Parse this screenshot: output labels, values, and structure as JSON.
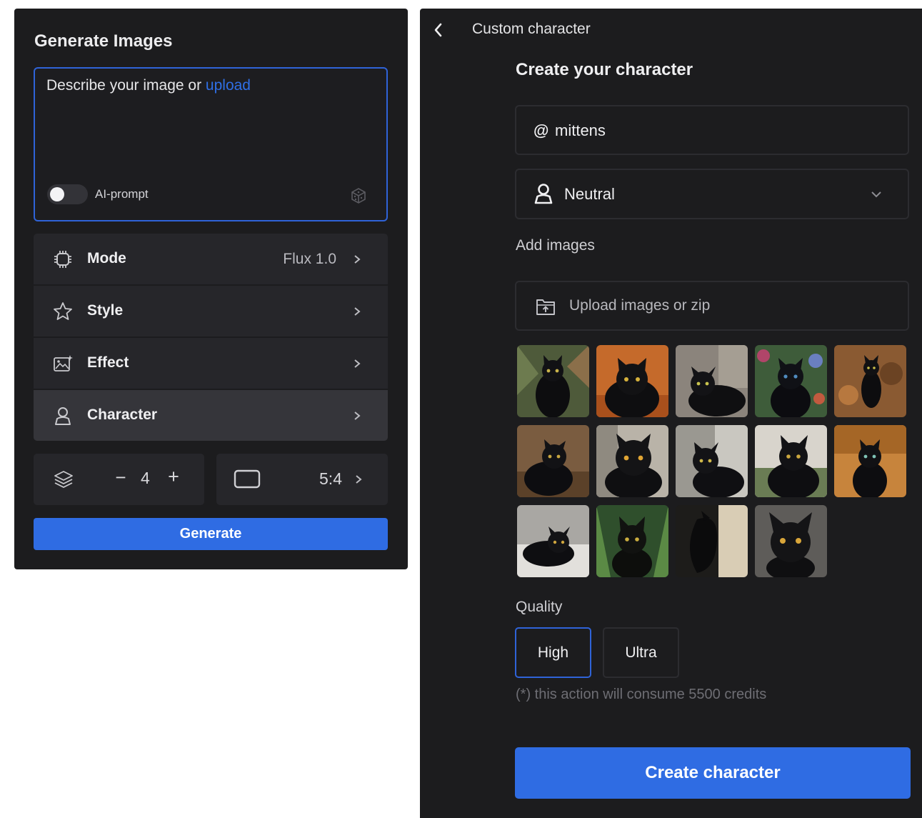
{
  "generate_panel": {
    "title": "Generate Images",
    "prompt": {
      "text": "Describe your image or ",
      "upload_link": "upload",
      "ai_prompt_label": "AI-prompt",
      "ai_prompt_enabled": false,
      "dice_icon": "dice-icon"
    },
    "menu": [
      {
        "icon": "chip-icon",
        "label": "Mode",
        "value": "Flux 1.0"
      },
      {
        "icon": "star-icon",
        "label": "Style",
        "value": ""
      },
      {
        "icon": "image-sparkle-icon",
        "label": "Effect",
        "value": ""
      },
      {
        "icon": "person-icon",
        "label": "Character",
        "value": "",
        "active": true
      }
    ],
    "count": {
      "icon": "layers-icon",
      "minus": "−",
      "value": "4",
      "plus": "+"
    },
    "ratio": {
      "icon": "aspect-ratio-icon",
      "value": "5:4"
    },
    "generate_label": "Generate",
    "accent": "#2f6ce3"
  },
  "character_panel": {
    "header": "Custom character",
    "title": "Create your character",
    "name_prefix": "@",
    "name_value": "mittens",
    "gender_value": "Neutral",
    "add_images_label": "Add images",
    "upload_label": "Upload images or zip",
    "images_count": 14,
    "images": [
      {
        "alt": "black cat among plants"
      },
      {
        "alt": "black cat on orange background"
      },
      {
        "alt": "black cat lying on grey fabric"
      },
      {
        "alt": "black cat among flowers"
      },
      {
        "alt": "black cat on autumn leaves"
      },
      {
        "alt": "black cat sitting on wood"
      },
      {
        "alt": "black cat close-up yellow eyes"
      },
      {
        "alt": "black cat on pale background"
      },
      {
        "alt": "black cat on garden"
      },
      {
        "alt": "black cat on warm background"
      },
      {
        "alt": "black cat lying on white sheet"
      },
      {
        "alt": "black cat in green grass"
      },
      {
        "alt": "black cat on beige background"
      },
      {
        "alt": "black cat portrait on grey"
      }
    ],
    "quality_label": "Quality",
    "quality_options": [
      "High",
      "Ultra"
    ],
    "quality_selected": "High",
    "credits_note": "(*) this action will consume 5500 credits",
    "create_label": "Create character"
  }
}
